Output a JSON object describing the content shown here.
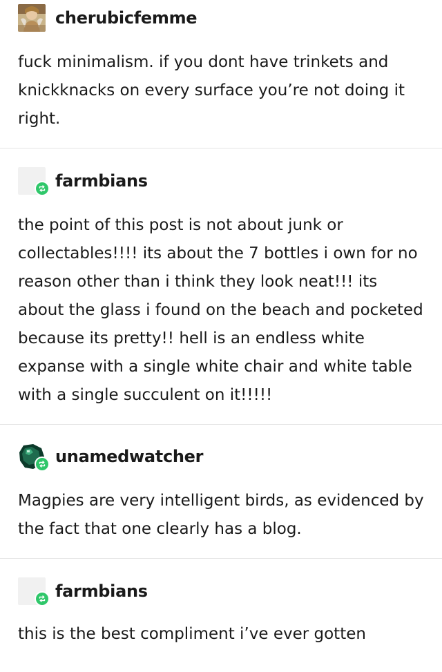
{
  "posts": [
    {
      "username": "cherubicfemme",
      "avatar": "painting-avatar",
      "reblog_badge": false,
      "text": "fuck minimalism. if you dont have trinkets and knickknacks on every surface you’re not doing it right."
    },
    {
      "username": "farmbians",
      "avatar": "blank-avatar",
      "reblog_badge": true,
      "text": "the point of this post is not about junk or collectables!!!! its about the 7 bottles i own for no reason other than i think they look neat!!! its about the glass i found on the beach and pocketed because its pretty!! hell is an endless white expanse with a single white chair and white table with a single succulent on it!!!!!"
    },
    {
      "username": "unamedwatcher",
      "avatar": "green-orb-avatar",
      "reblog_badge": true,
      "text": "Magpies are very intelligent birds, as evidenced by the fact that one clearly has a blog."
    },
    {
      "username": "farmbians",
      "avatar": "blank-avatar",
      "reblog_badge": true,
      "text": "this is the best compliment i’ve ever gotten"
    }
  ],
  "colors": {
    "reblog_green": "#2fc76a",
    "divider": "#e4e4e4",
    "text": "#1a1a1a"
  }
}
